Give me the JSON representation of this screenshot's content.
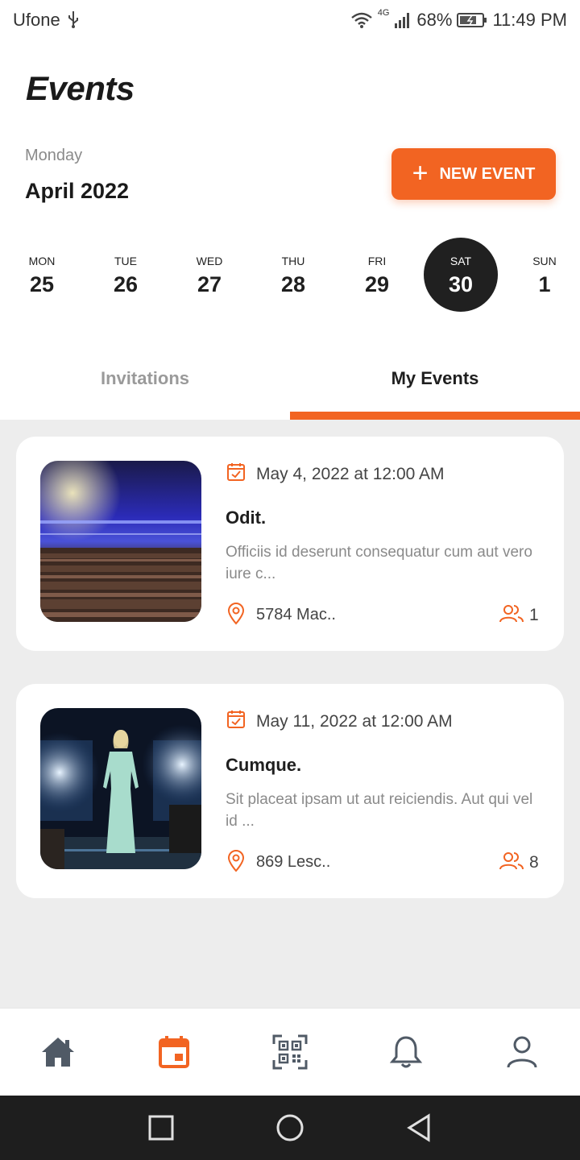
{
  "status_bar": {
    "carrier": "Ufone",
    "network": "4G",
    "battery": "68%",
    "time": "11:49 PM"
  },
  "header": {
    "title": "Events",
    "day": "Monday",
    "month": "April 2022",
    "new_event_label": "NEW EVENT"
  },
  "week": [
    {
      "name": "MON",
      "date": "25"
    },
    {
      "name": "TUE",
      "date": "26"
    },
    {
      "name": "WED",
      "date": "27"
    },
    {
      "name": "THU",
      "date": "28"
    },
    {
      "name": "FRI",
      "date": "29"
    },
    {
      "name": "SAT",
      "date": "30"
    },
    {
      "name": "SUN",
      "date": "1"
    }
  ],
  "selected_day": "SAT",
  "tabs": {
    "invitations": "Invitations",
    "my_events": "My Events",
    "active": "My Events"
  },
  "events": [
    {
      "date": "May 4, 2022 at 12:00 AM",
      "title": "Odit.",
      "description": "Officiis id deserunt consequatur cum aut vero iure c...",
      "location": "5784 Mac..",
      "attendees": "1",
      "image": "concert-crowd-photo"
    },
    {
      "date": "May 11, 2022 at 12:00 AM",
      "title": "Cumque.",
      "description": "Sit placeat ipsam ut aut reiciendis. Aut qui vel id ...",
      "location": "869 Lesc..",
      "attendees": "8",
      "image": "fashion-runway-photo"
    }
  ],
  "bottom_nav": {
    "items": [
      "home-icon",
      "calendar-icon",
      "qr-scan-icon",
      "bell-icon",
      "profile-icon"
    ],
    "active": "calendar-icon"
  },
  "colors": {
    "accent": "#f26422",
    "selected_day_bg": "#202020",
    "background": "#ededed"
  }
}
